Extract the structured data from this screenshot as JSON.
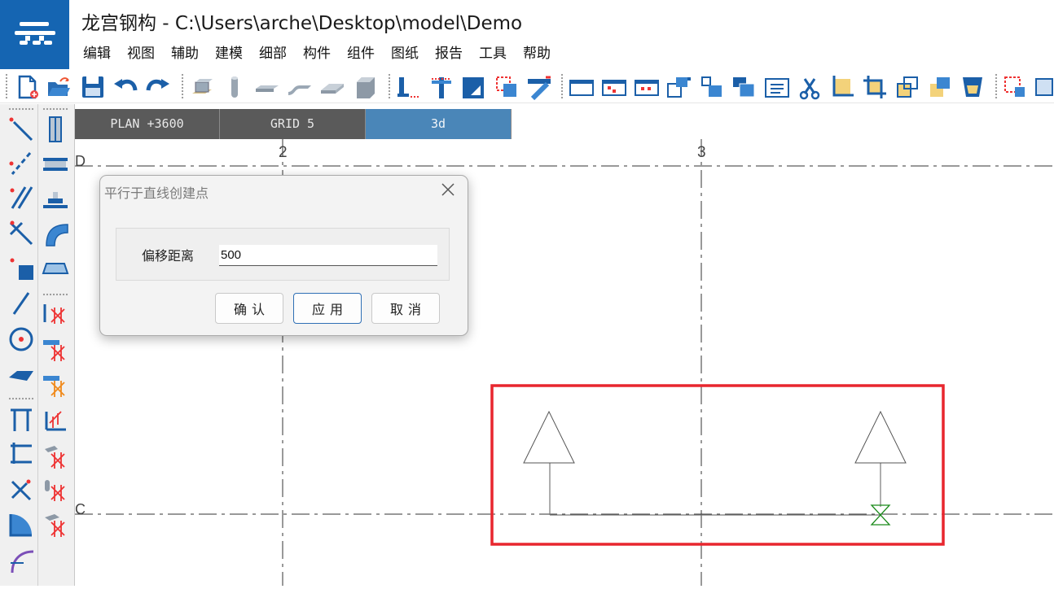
{
  "app": {
    "title": "龙宫钢构 - C:\\Users\\arche\\Desktop\\model\\Demo",
    "logo_icon": "app-logo-icon",
    "brand_color": "#1565b2"
  },
  "menu": [
    "编辑",
    "视图",
    "辅助",
    "建模",
    "细部",
    "构件",
    "组件",
    "图纸",
    "报告",
    "工具",
    "帮助"
  ],
  "toolbar": {
    "icons": [
      "new-file-icon",
      "open-folder-icon",
      "save-icon",
      "undo-icon",
      "redo-icon",
      "beam-cube-icon",
      "column-icon",
      "plate-icon",
      "bent-plate-icon",
      "slab-icon",
      "block-icon",
      "column-base-icon",
      "connection-icon",
      "corner-plate-icon",
      "dashed-frame-icon",
      "diagonal-brace-icon",
      "window-icon",
      "window-dots-icon",
      "window-dots2-icon",
      "grid-copy-icon",
      "move-icon",
      "stack-icon",
      "properties-icon",
      "scissors-icon",
      "fit-icon",
      "cut-icon",
      "copy-icon",
      "overlap-icon",
      "bucket-icon",
      "select-box-icon",
      "select-box2-icon"
    ]
  },
  "palette": {
    "left_icons": [
      "line-icon",
      "dashed-line-icon",
      "parallel-lines-icon",
      "perpendicular-icon",
      "point-square-icon",
      "slash-icon",
      "circle-target-icon",
      "plane-icon",
      "frame-icon",
      "bracket-icon",
      "cross-tool-icon",
      "quarter-circle-icon",
      "arc-icon"
    ],
    "right_icons": [
      "column-profile-icon",
      "i-beam-icon",
      "stair-icon",
      "curved-beam-icon",
      "plate-profile-icon",
      "grid-x-icon",
      "grid-x2-icon",
      "grid-x3-icon",
      "grid-x4-icon",
      "grid-x5-icon",
      "grid-x6-icon",
      "grid-x7-icon"
    ]
  },
  "tabs": [
    {
      "label": "PLAN +3600",
      "active": false
    },
    {
      "label": "GRID 5",
      "active": false
    },
    {
      "label": "3d",
      "active": true
    }
  ],
  "grid": {
    "vertical_labels": [
      "2",
      "3"
    ],
    "horizontal_labels": [
      "D",
      "C"
    ]
  },
  "selection_color": "#e8262e",
  "dialog": {
    "title": "平行于直线创建点",
    "offset_label": "偏移距离",
    "offset_value": "500",
    "confirm_label": "确认",
    "apply_label": "应用",
    "cancel_label": "取消"
  }
}
